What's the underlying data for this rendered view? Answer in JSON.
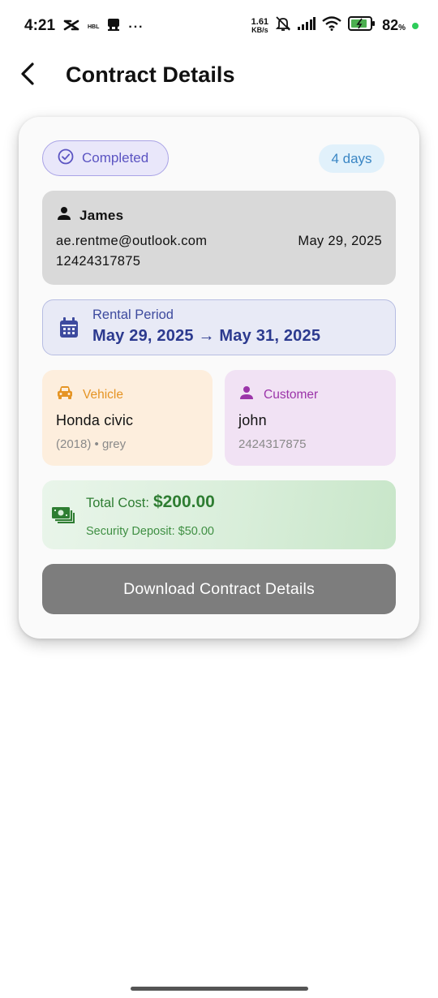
{
  "status_bar": {
    "time": "4:21",
    "net_speed_value": "1.61",
    "net_speed_unit": "KB/s",
    "battery_percent": "82",
    "battery_unit": "%",
    "carrier_label": "HBL",
    "more": "···"
  },
  "app_bar": {
    "title": "Contract Details"
  },
  "contract": {
    "status_label": "Completed",
    "duration_label": "4 days",
    "person": {
      "name": "James",
      "email": "ae.rentme@outlook.com",
      "date": "May 29, 2025",
      "phone": "12424317875"
    },
    "rental_period": {
      "label": "Rental Period",
      "dates": "May 29, 2025 → May 31, 2025"
    },
    "vehicle": {
      "label": "Vehicle",
      "name": "Honda civic",
      "detail": "(2018) • grey"
    },
    "customer": {
      "label": "Customer",
      "name": "john",
      "phone": "2424317875"
    },
    "cost": {
      "total_label": "Total Cost:",
      "total_value": "$200.00",
      "deposit_text": "Security Deposit: $50.00"
    },
    "download_label": "Download Contract Details"
  },
  "colors": {
    "accent_purple": "#5b54c2",
    "rental_blue": "#2c3a8f",
    "vehicle_orange": "#e59424",
    "customer_purple": "#9b34a9",
    "cost_green": "#2e7d32",
    "button_grey": "#7d7d7d"
  },
  "icons": {
    "back": "arrow-back-icon",
    "status": "check-circle-icon",
    "person": "person-icon",
    "calendar": "calendar-icon",
    "vehicle": "car-icon",
    "customer": "person-icon",
    "cost": "money-icon"
  }
}
